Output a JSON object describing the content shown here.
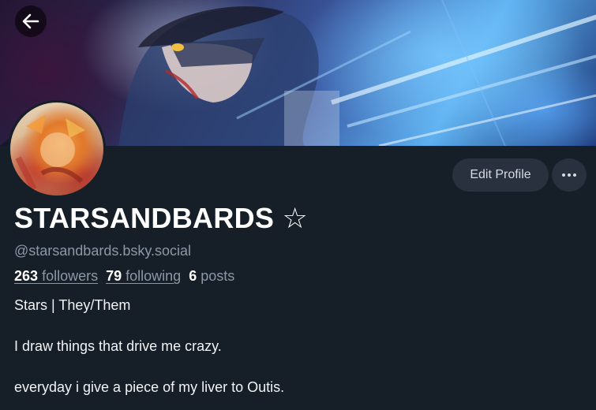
{
  "header": {
    "back_icon": "arrow-left-icon"
  },
  "profile": {
    "display_name": "STARSANDBARDS ☆",
    "handle": "@starsandbards.bsky.social",
    "followers_count": "263",
    "followers_label": "followers",
    "following_count": "79",
    "following_label": "following",
    "posts_count": "6",
    "posts_label": "posts",
    "bio": [
      "Stars | They/Them",
      "I draw things that drive me crazy.",
      "everyday i give a piece of my liver to Outis."
    ]
  },
  "actions": {
    "edit_label": "Edit Profile",
    "more_icon": "ellipsis-icon"
  },
  "colors": {
    "background": "#161e27",
    "button_bg": "#28313d",
    "muted_text": "#8b98a6"
  }
}
